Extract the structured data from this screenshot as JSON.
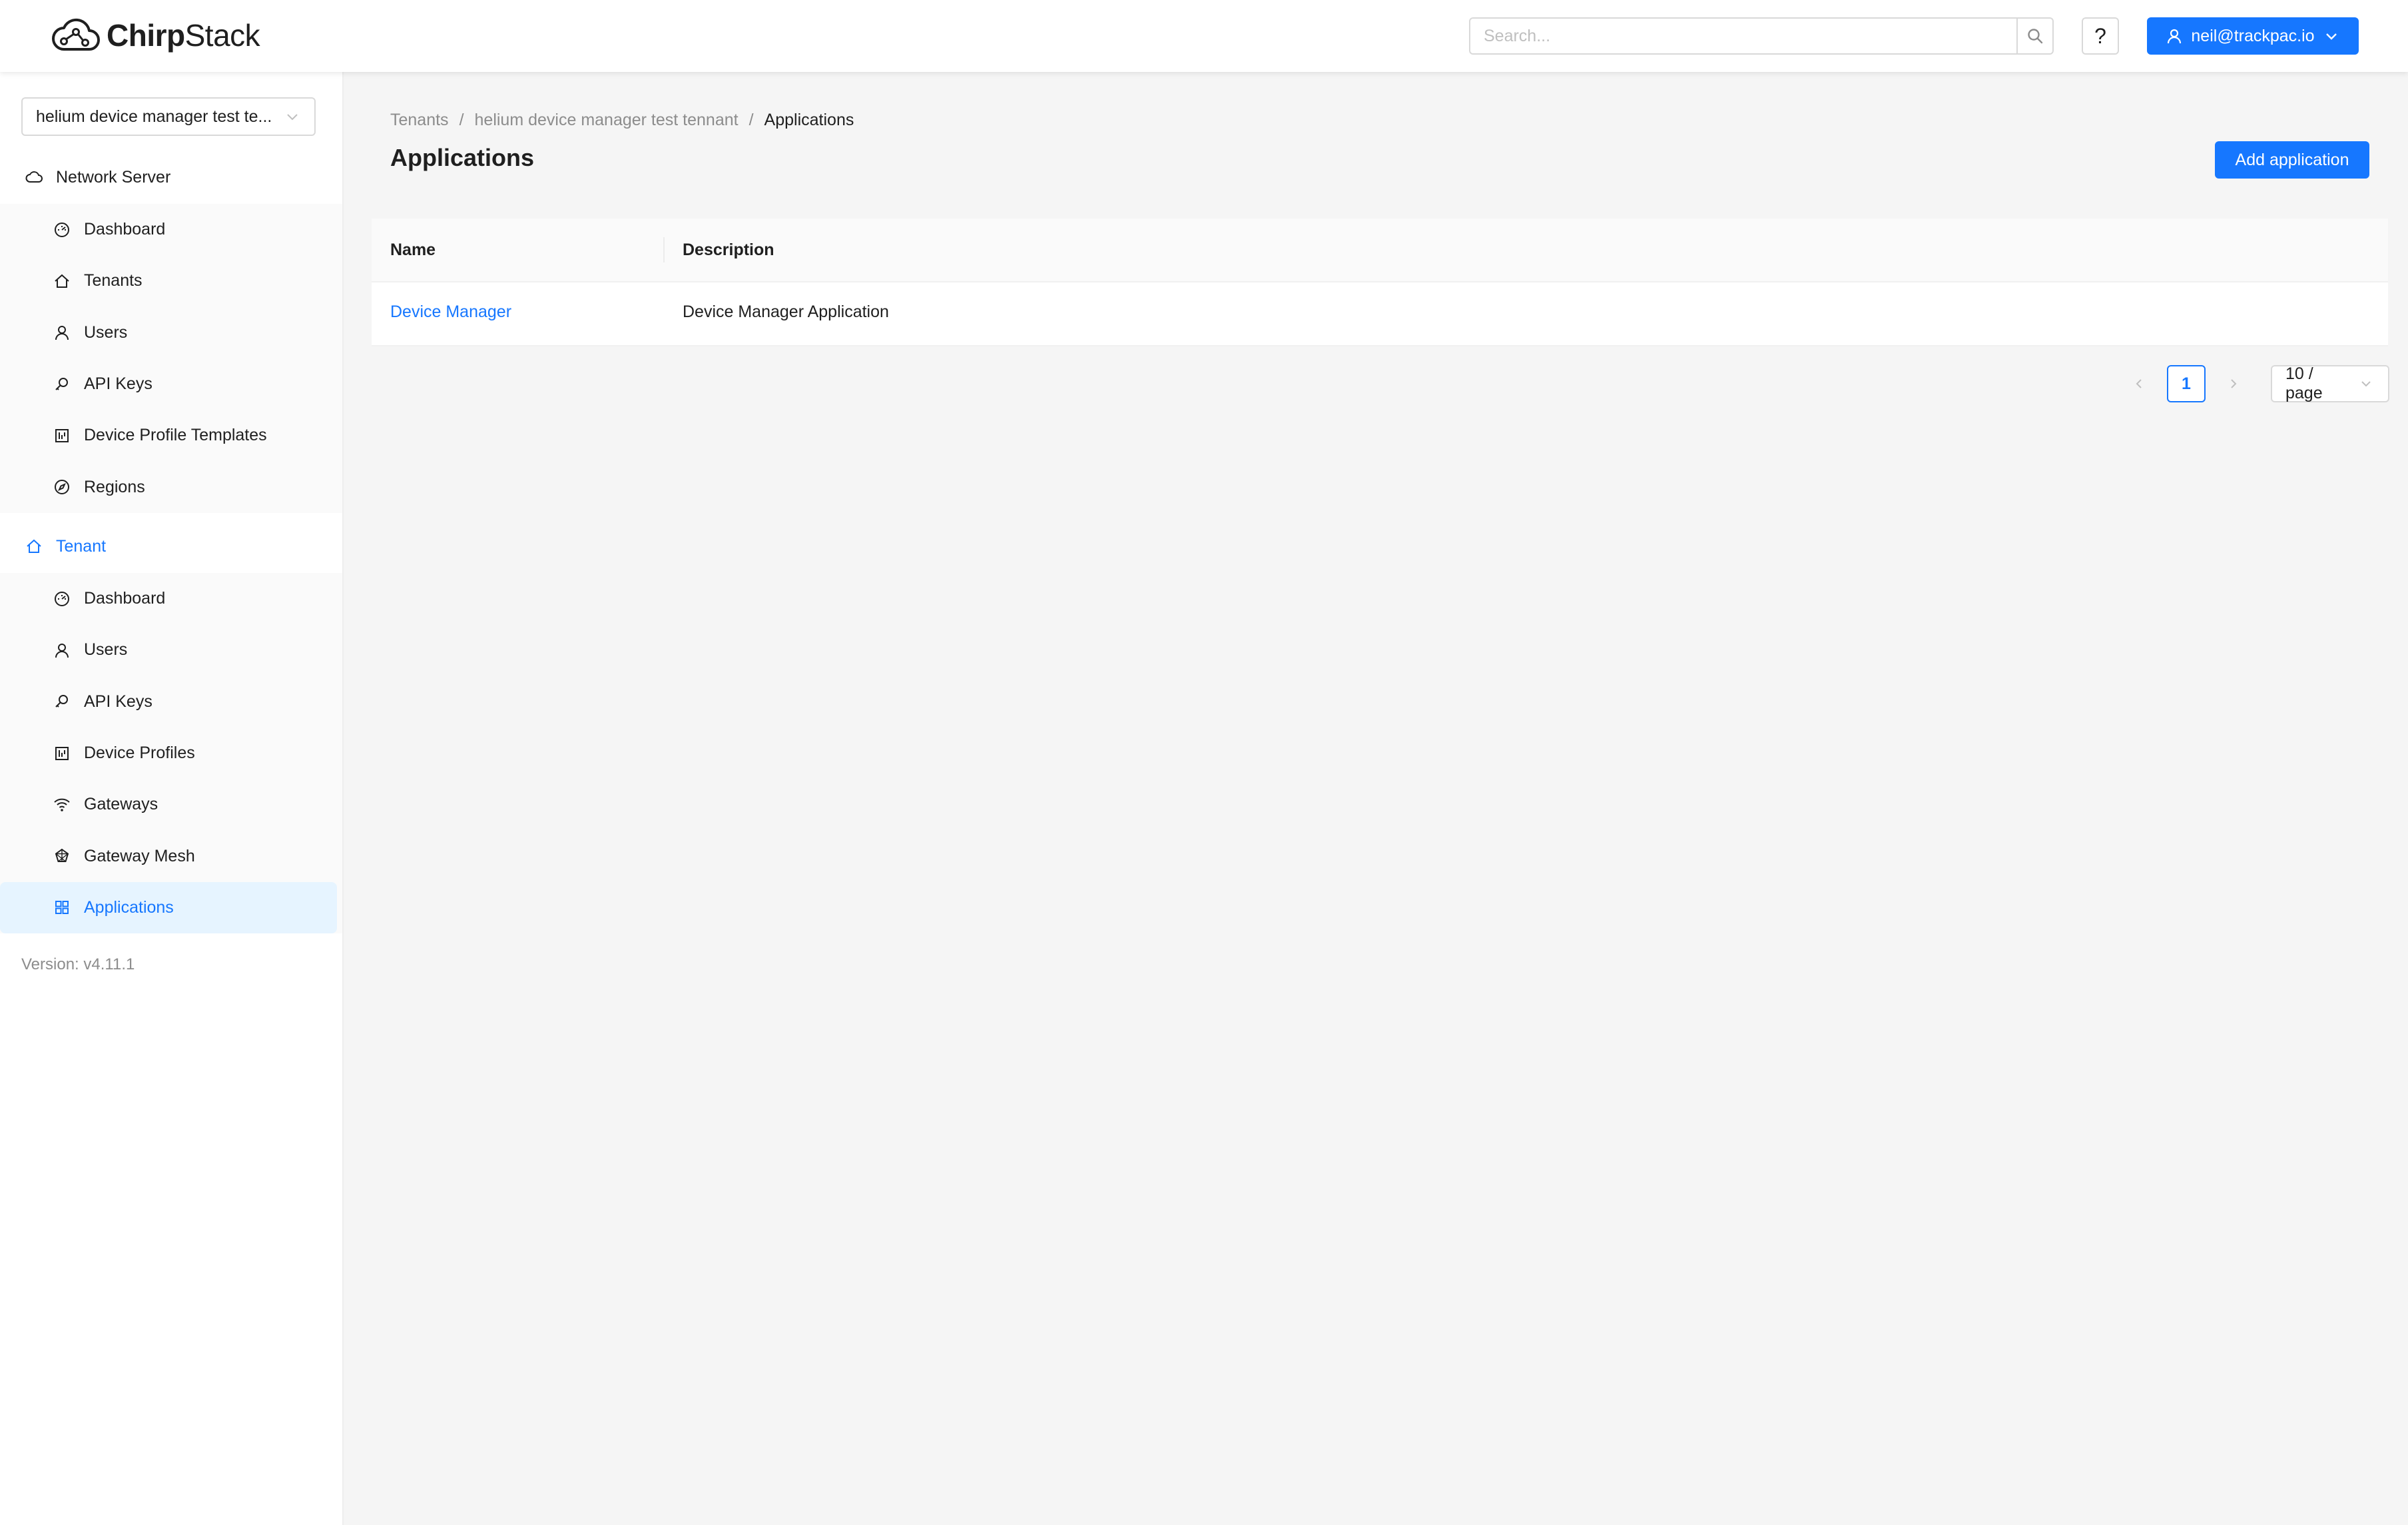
{
  "app": {
    "logo_text_bold": "Chirp",
    "logo_text_rest": "Stack",
    "logo_icon": "cloud-logo-icon"
  },
  "header": {
    "search_placeholder": "Search...",
    "search_icon": "search-icon",
    "help_label": "?",
    "user_label": "neil@trackpac.io"
  },
  "sidebar": {
    "tenant_select_value": "helium device manager test te...",
    "network_server": {
      "label": "Network Server",
      "items": [
        {
          "label": "Dashboard",
          "icon": "dashboard-icon"
        },
        {
          "label": "Tenants",
          "icon": "home-icon"
        },
        {
          "label": "Users",
          "icon": "user-icon"
        },
        {
          "label": "API Keys",
          "icon": "key-icon"
        },
        {
          "label": "Device Profile Templates",
          "icon": "profile-icon"
        },
        {
          "label": "Regions",
          "icon": "compass-icon"
        }
      ]
    },
    "tenant": {
      "label": "Tenant",
      "items": [
        {
          "label": "Dashboard",
          "icon": "dashboard-icon"
        },
        {
          "label": "Users",
          "icon": "user-icon"
        },
        {
          "label": "API Keys",
          "icon": "key-icon"
        },
        {
          "label": "Device Profiles",
          "icon": "profile-icon"
        },
        {
          "label": "Gateways",
          "icon": "wifi-icon"
        },
        {
          "label": "Gateway Mesh",
          "icon": "mesh-icon"
        },
        {
          "label": "Applications",
          "icon": "appstore-icon"
        }
      ]
    },
    "version": "Version: v4.11.1",
    "colors": {
      "accent": "#1677ff",
      "active_bg": "#e6f4ff"
    }
  },
  "main": {
    "breadcrumb": [
      "Tenants",
      "helium device manager test tennant",
      "Applications"
    ],
    "breadcrumb_sep": "/",
    "title": "Applications",
    "add_button": "Add application",
    "table": {
      "columns": [
        "Name",
        "Description"
      ],
      "rows": [
        {
          "name": "Device Manager",
          "description": "Device Manager Application"
        }
      ]
    },
    "pagination": {
      "current_page": "1",
      "page_size": "10 / page"
    }
  }
}
